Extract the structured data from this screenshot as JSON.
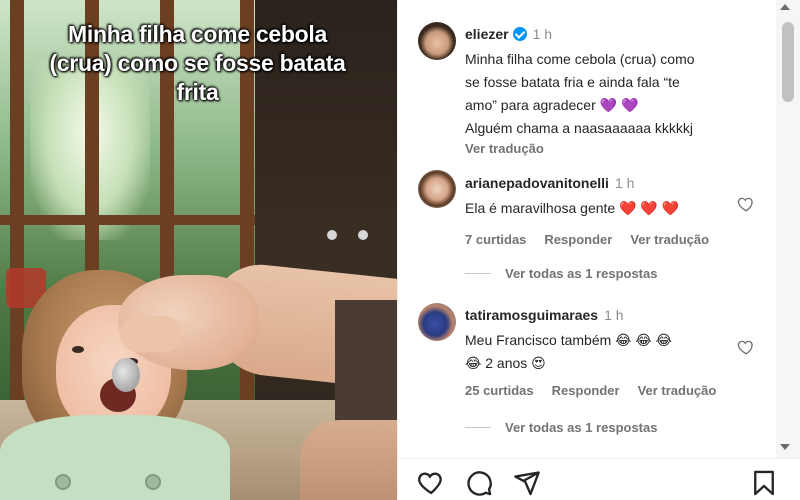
{
  "post": {
    "overlay_caption": "Minha filha come cebola (crua) como se fosse batata frita",
    "author": {
      "username": "eliezer",
      "verified": true,
      "time": "1 h"
    },
    "caption_lines": [
      "Minha filha come cebola (crua) como",
      "se fosse batata fria e ainda fala “te",
      "amo” para agradecer 💜 💜",
      "Alguém chama a naasaaaaaa kkkkkj"
    ],
    "see_translation": "Ver tradução"
  },
  "comments": [
    {
      "username": "arianepadovanitonelli",
      "time": "1 h",
      "lines": [
        "Ela é maravilhosa gente ❤️ ❤️ ❤️"
      ],
      "likes": "7 curtidas",
      "reply": "Responder",
      "translate": "Ver tradução",
      "view_replies": "Ver todas as 1 respostas"
    },
    {
      "username": "tatiramosguimaraes",
      "time": "1 h",
      "lines": [
        "Meu Francisco também 😂 😂 😂",
        "😂 2 anos 😍"
      ],
      "likes": "25 curtidas",
      "reply": "Responder",
      "translate": "Ver tradução",
      "view_replies": "Ver todas as 1 respostas"
    }
  ],
  "actions": {
    "icons": [
      "heart-icon",
      "comment-icon",
      "share-icon",
      "bookmark-icon"
    ]
  },
  "colors": {
    "verified": "#0095f6",
    "like_heart": "#ed4956",
    "secondary_text": "#737373"
  }
}
